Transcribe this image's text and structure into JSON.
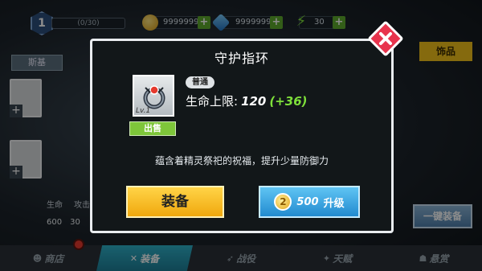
{
  "hud": {
    "level": "1",
    "xp": "(0/30)",
    "gold": "99999999",
    "gems": "99999999",
    "energy": "30",
    "plus": "+"
  },
  "background": {
    "basic_tab": "斯基",
    "jewelry_tab": "饰品",
    "one_key_equip": "一键装备",
    "slot_add": "+",
    "stat_labels": [
      "生命",
      "攻击"
    ],
    "stat_values": [
      "600",
      "30"
    ]
  },
  "modal": {
    "title": "守护指环",
    "item_level": "Lv.1",
    "sell_label": "出售",
    "rarity": "普通",
    "stat_label": "生命上限:",
    "stat_value": "120",
    "stat_bonus": "(+36)",
    "description": "蕴含着精灵祭祀的祝福，提升少量防御力",
    "equip_label": "装备",
    "upgrade_cost": "500",
    "upgrade_label": "升级"
  },
  "nav": [
    {
      "label": "商店",
      "icon": "shop-icon",
      "glyph": "☻"
    },
    {
      "label": "装备",
      "icon": "swords-icon",
      "glyph": "✕"
    },
    {
      "label": "战役",
      "icon": "battle-icon",
      "glyph": "➶"
    },
    {
      "label": "天赋",
      "icon": "talent-icon",
      "glyph": "✦"
    },
    {
      "label": "悬赏",
      "icon": "bounty-icon",
      "glyph": "☗"
    }
  ],
  "colors": {
    "active_tab": "#1d9cb8",
    "equip_button": "#f4b419",
    "upgrade_button": "#2f9ee0",
    "sell_button": "#7ec63a",
    "close_button": "#e8344d",
    "bonus_text": "#7ee03a"
  }
}
